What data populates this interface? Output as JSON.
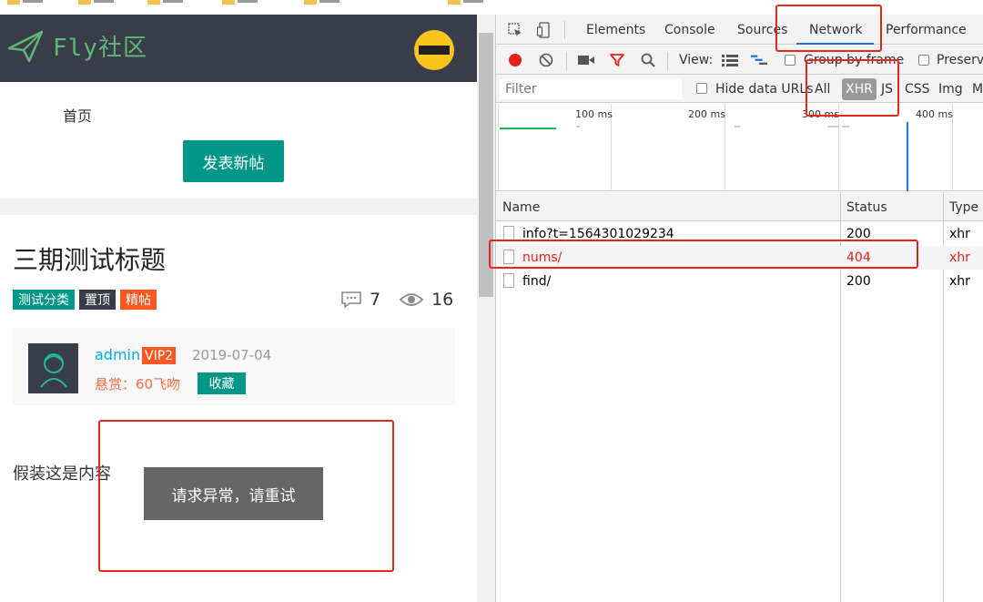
{
  "app": {
    "logo_text": "Fly社区",
    "nav_home": "首页",
    "post_button": "发表新帖",
    "post": {
      "title": "三期测试标题",
      "badges": [
        "测试分类",
        "置顶",
        "精帖"
      ],
      "comments": "7",
      "views": "16",
      "author": "admin",
      "vip": "VIP2",
      "date": "2019-07-04",
      "reward": "悬赏：60飞吻",
      "favorite": "收藏",
      "content": "假装这是内容"
    },
    "toast": "请求异常，请重试"
  },
  "devtools": {
    "tabs": [
      "Elements",
      "Console",
      "Sources",
      "Network",
      "Performance"
    ],
    "active_tab": "Network",
    "toolbar": {
      "view_label": "View:",
      "group_by_frame": "Group by frame",
      "preserve_log": "Preserve"
    },
    "filter": {
      "placeholder": "Filter",
      "hide_data_urls": "Hide data URLs",
      "types": [
        "All",
        "XHR",
        "JS",
        "CSS",
        "Img",
        "M"
      ],
      "active_type": "XHR"
    },
    "timeline_labels": [
      "100 ms",
      "200 ms",
      "300 ms",
      "400 ms"
    ],
    "columns": [
      "Name",
      "Status",
      "Type"
    ],
    "requests": [
      {
        "name": "info?t=1564301029234",
        "status": "200",
        "type": "xhr"
      },
      {
        "name": "nums/",
        "status": "404",
        "type": "xhr"
      },
      {
        "name": "find/",
        "status": "200",
        "type": "xhr"
      }
    ]
  },
  "colors": {
    "header_bg": "#393D49",
    "primary": "#009688",
    "danger": "#FF5722",
    "link": "#01AAED",
    "annotation": "#e4281e"
  }
}
